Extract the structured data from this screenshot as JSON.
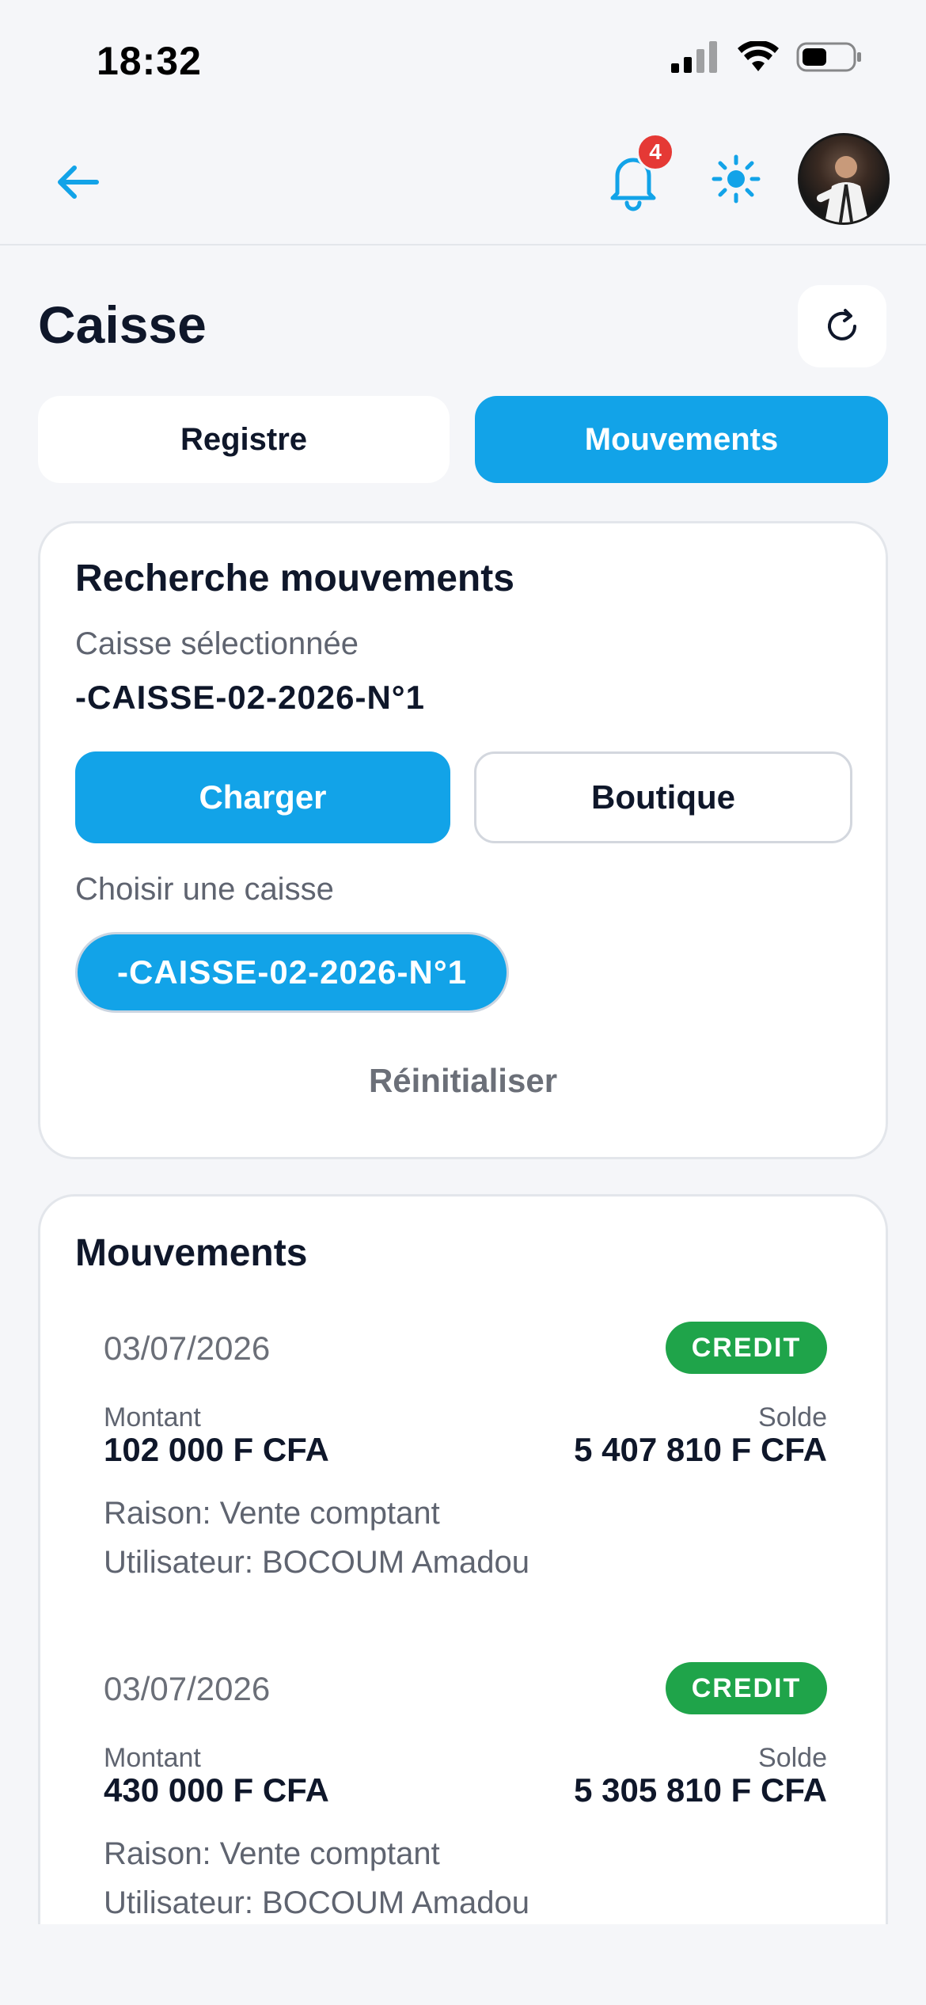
{
  "status_bar": {
    "time": "18:32"
  },
  "header": {
    "notifications_count": "4",
    "back_icon": "arrow-left-icon",
    "bell_icon": "bell-icon",
    "theme_icon": "sun-icon"
  },
  "page": {
    "title": "Caisse"
  },
  "tabs": [
    {
      "label": "Registre",
      "active": false
    },
    {
      "label": "Mouvements",
      "active": true
    }
  ],
  "search": {
    "title": "Recherche mouvements",
    "selected_label": "Caisse sélectionnée",
    "selected_value": "-CAISSE-02-2026-N°1",
    "load_button": "Charger",
    "shop_button": "Boutique",
    "choose_label": "Choisir une caisse",
    "chip": "-CAISSE-02-2026-N°1",
    "reset": "Réinitialiser"
  },
  "movements": {
    "title": "Mouvements",
    "amount_label": "Montant",
    "balance_label": "Solde",
    "items": [
      {
        "date": "03/07/2026",
        "type": "CREDIT",
        "amount": "102 000 F CFA",
        "balance": "5 407 810 F CFA",
        "reason": "Raison: Vente comptant",
        "user": "Utilisateur: BOCOUM Amadou"
      },
      {
        "date": "03/07/2026",
        "type": "CREDIT",
        "amount": "430 000 F CFA",
        "balance": "5 305 810 F CFA",
        "reason": "Raison: Vente comptant",
        "user": "Utilisateur: BOCOUM Amadou"
      }
    ]
  },
  "colors": {
    "accent": "#12A3E8",
    "credit": "#1FA44A",
    "badge": "#E53935",
    "background": "#F5F6F9"
  }
}
